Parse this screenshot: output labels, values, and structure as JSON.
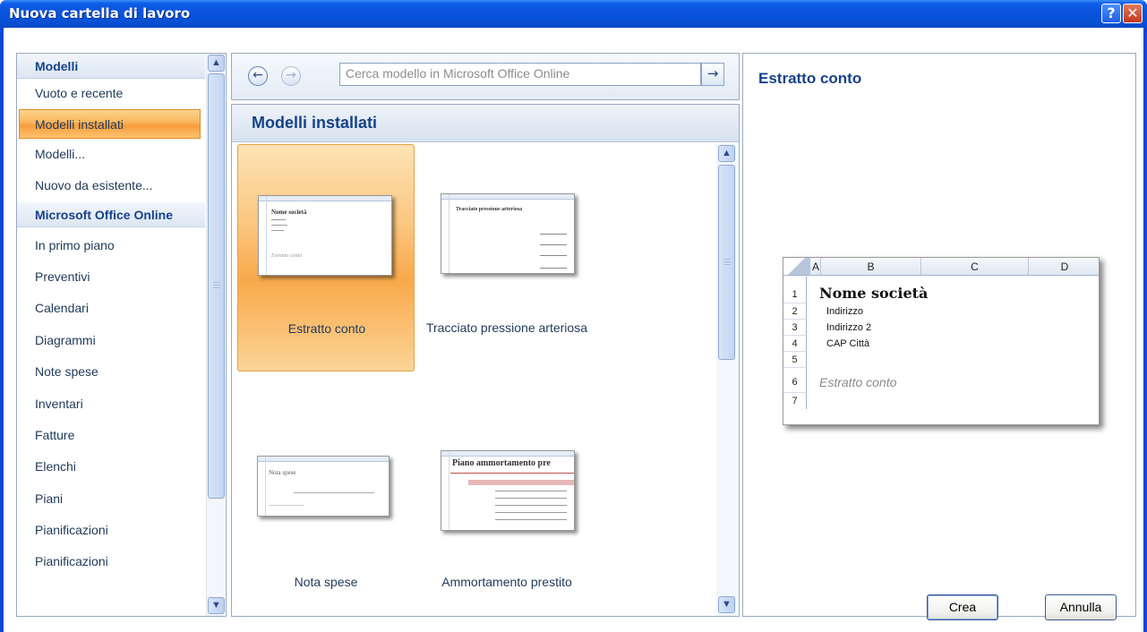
{
  "window": {
    "title": "Nuova cartella di lavoro",
    "help_label": "?",
    "close_label": "✕"
  },
  "sidebar": {
    "sections": [
      {
        "header": "Modelli",
        "items": [
          {
            "label": "Vuoto e recente",
            "selected": false
          },
          {
            "label": "Modelli installati",
            "selected": true
          },
          {
            "label": "Modelli...",
            "selected": false
          },
          {
            "label": "Nuovo da esistente...",
            "selected": false
          }
        ]
      },
      {
        "header": "Microsoft Office Online",
        "items": [
          {
            "label": "In primo piano"
          },
          {
            "label": "Preventivi"
          },
          {
            "label": "Calendari"
          },
          {
            "label": "Diagrammi"
          },
          {
            "label": "Note spese"
          },
          {
            "label": "Inventari"
          },
          {
            "label": "Fatture"
          },
          {
            "label": "Elenchi"
          },
          {
            "label": "Piani"
          },
          {
            "label": "Pianificazioni"
          },
          {
            "label": "Pianificazioni"
          }
        ]
      }
    ]
  },
  "toolbar": {
    "back_icon": "back-arrow-icon",
    "forward_icon": "forward-arrow-icon",
    "search_placeholder": "Cerca modello in Microsoft Office Online",
    "go_icon": "go-arrow-icon"
  },
  "gallery": {
    "title": "Modelli installati",
    "templates": [
      {
        "label": "Estratto conto",
        "selected": true
      },
      {
        "label": "Tracciato pressione arteriosa",
        "selected": false
      },
      {
        "label": "Nota spese",
        "selected": false
      },
      {
        "label": "Ammortamento prestito",
        "selected": false
      }
    ],
    "thumb_text": {
      "estratto_title": "Nome società",
      "estratto_subtitle": "Estratto conto",
      "tracciato_title": "Tracciato pressione arteriosa",
      "nota_title": "Nota spese",
      "ammortamento_title": "Piano ammortamento pre"
    }
  },
  "preview": {
    "title": "Estratto conto",
    "columns": [
      "A",
      "B",
      "C",
      "D"
    ],
    "rows": [
      "1",
      "2",
      "3",
      "4",
      "5",
      "6",
      "7"
    ],
    "company": "Nome società",
    "address1": "Indirizzo",
    "address2": "Indirizzo 2",
    "city": "CAP Città",
    "doc_title": "Estratto conto"
  },
  "footer": {
    "create_label": "Crea",
    "cancel_label": "Annulla"
  }
}
